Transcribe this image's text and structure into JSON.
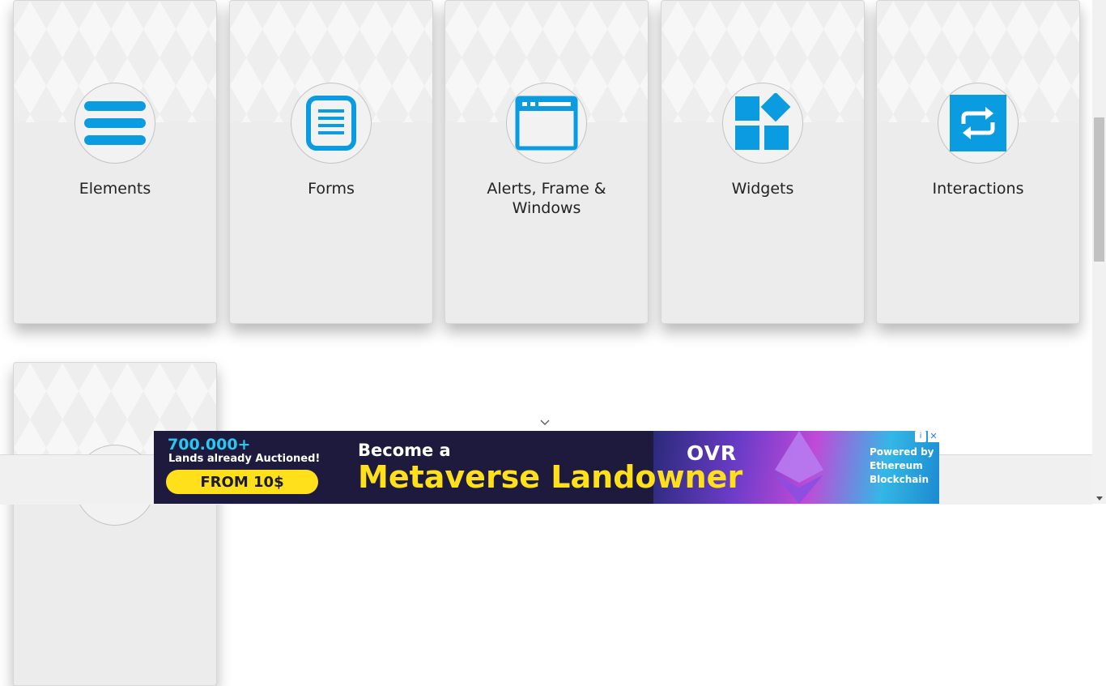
{
  "cards": [
    {
      "title": "Elements",
      "icon": "hamburger-icon"
    },
    {
      "title": "Forms",
      "icon": "document-icon"
    },
    {
      "title": "Alerts, Frame & Windows",
      "icon": "browser-window-icon"
    },
    {
      "title": "Widgets",
      "icon": "widgets-grid-icon"
    },
    {
      "title": "Interactions",
      "icon": "repeat-arrows-icon"
    }
  ],
  "colors": {
    "accent": "#0b9be0",
    "card_bg": "#ececec"
  },
  "ad": {
    "count": "700.000+",
    "subtitle": "Lands already Auctioned!",
    "cta": "FROM 10$",
    "line1": "Become a",
    "line2": "Metaverse Landowner",
    "brand": "OVR",
    "powered": "Powered by Ethereum Blockchain"
  }
}
